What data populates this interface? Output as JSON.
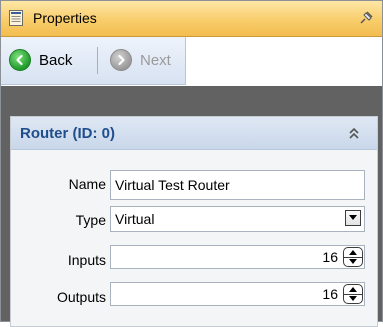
{
  "window": {
    "title": "Properties",
    "title_icon": "document-icon",
    "pin_icon": "pin-icon"
  },
  "nav": {
    "back_label": "Back",
    "next_label": "Next",
    "next_enabled": false
  },
  "panel": {
    "title": "Router (ID: 0)",
    "collapse_icon": "chevron-up-double-icon",
    "fields": {
      "name": {
        "label": "Name",
        "value": "Virtual Test Router"
      },
      "type": {
        "label": "Type",
        "value": "Virtual"
      },
      "inputs": {
        "label": "Inputs",
        "value": "16"
      },
      "outputs": {
        "label": "Outputs",
        "value": "16"
      }
    }
  },
  "colors": {
    "title_gradient": "#f8cd6b",
    "panel_title": "#1f4e8c",
    "background_dark": "#626262",
    "nav_back_icon": "#1f9b2a"
  }
}
